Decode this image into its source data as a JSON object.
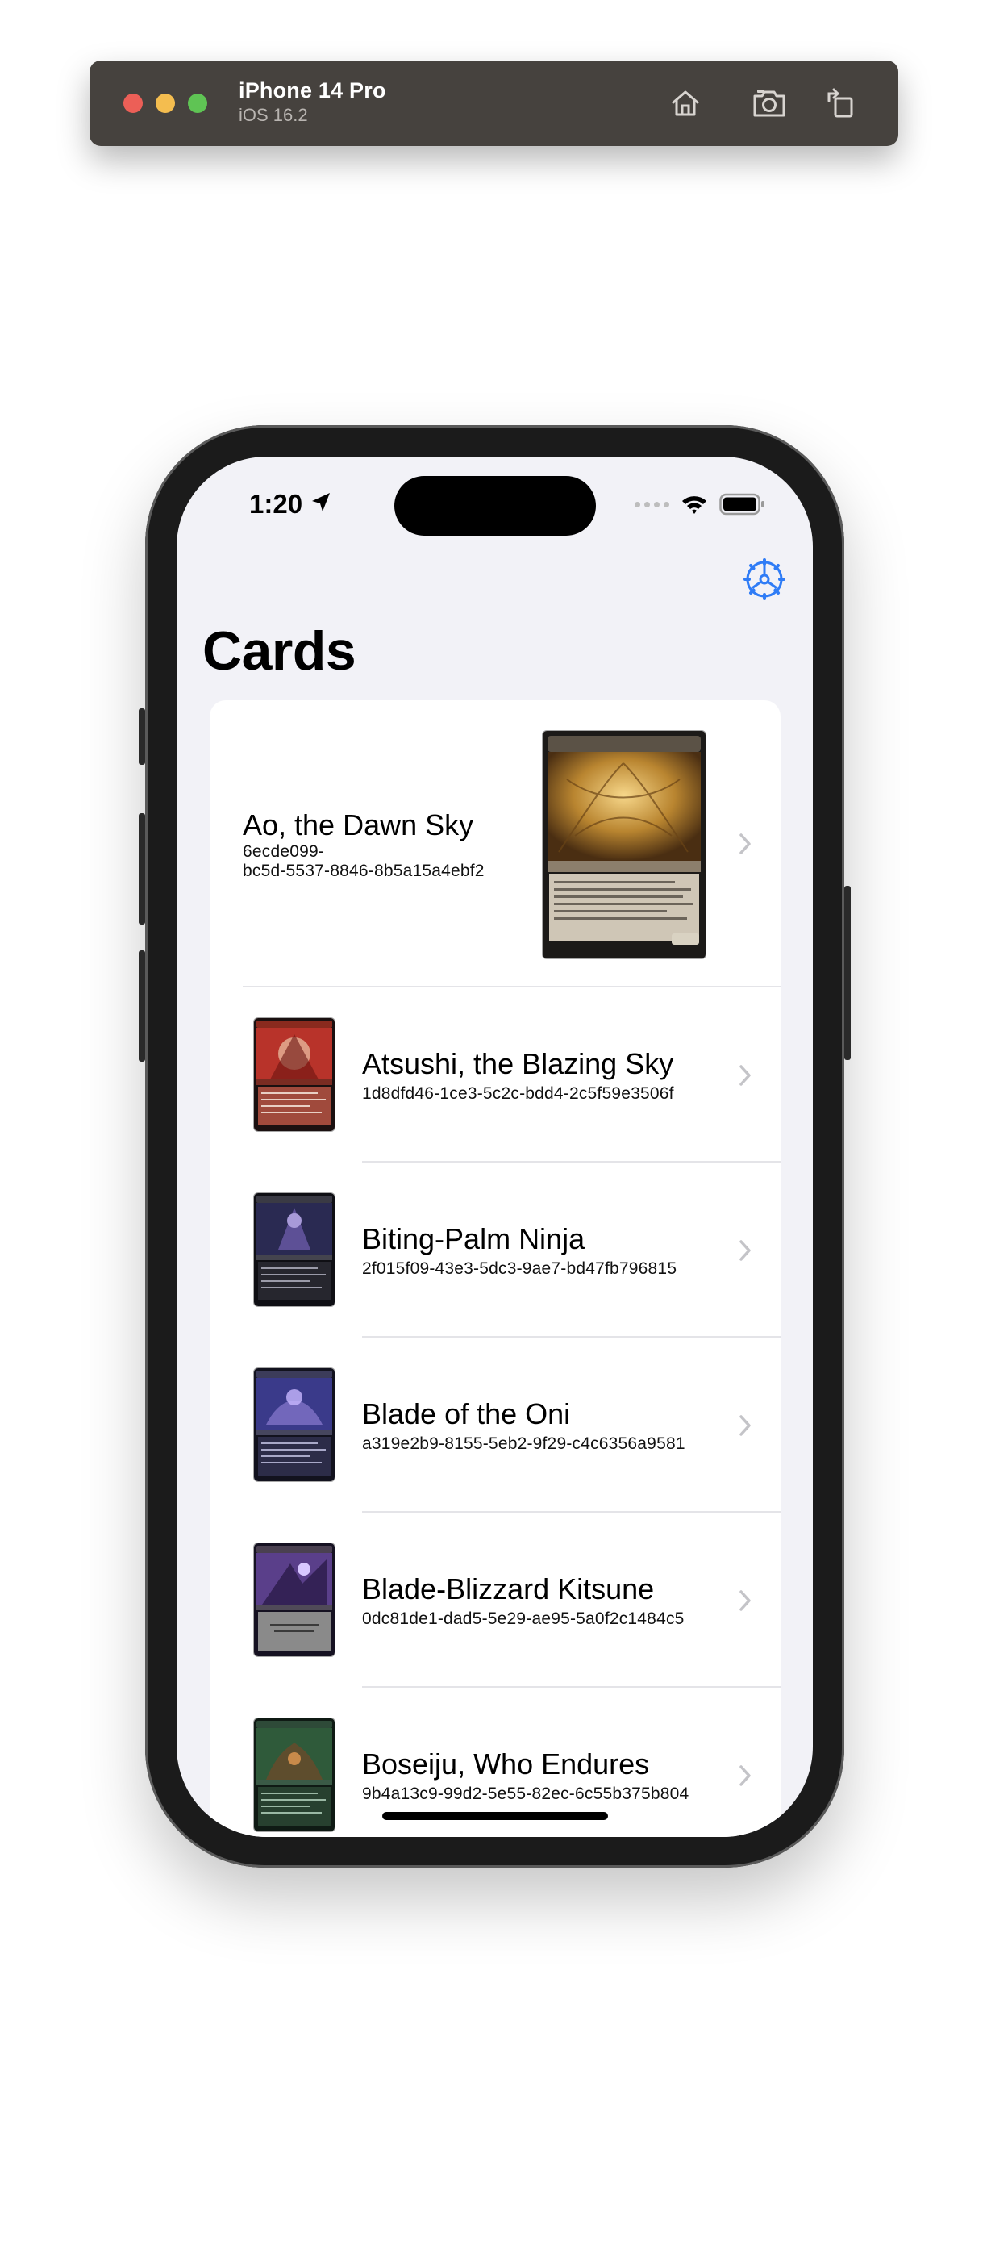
{
  "simulator": {
    "device_name": "iPhone 14 Pro",
    "os_version": "iOS 16.2",
    "buttons": [
      "home-icon",
      "screenshot-icon",
      "rotate-icon"
    ]
  },
  "status_bar": {
    "time": "1:20"
  },
  "nav": {
    "title": "Cards",
    "settings_icon": "gear-icon"
  },
  "cards": [
    {
      "name": "Ao, the Dawn Sky",
      "uuid": "6ecde099-\nbc5d-5537-8846-8b5a15a4ebf2",
      "art": "gold"
    },
    {
      "name": "Atsushi, the Blazing Sky",
      "uuid": "1d8dfd46-1ce3-5c2c-bdd4-2c5f59e3506f",
      "art": "red"
    },
    {
      "name": "Biting-Palm Ninja",
      "uuid": "2f015f09-43e3-5dc3-9ae7-bd47fb796815",
      "art": "black"
    },
    {
      "name": "Blade of the Oni",
      "uuid": "a319e2b9-8155-5eb2-9f29-c4c6356a9581",
      "art": "indigo"
    },
    {
      "name": "Blade-Blizzard Kitsune",
      "uuid": "0dc81de1-dad5-5e29-ae95-5a0f2c1484c5",
      "art": "purple"
    },
    {
      "name": "Boseiju, Who Endures",
      "uuid": "9b4a13c9-99d2-5e55-82ec-6c55b375b804",
      "art": "green"
    }
  ],
  "colors": {
    "accent": "#2f7cf6",
    "background": "#f2f2f7"
  }
}
